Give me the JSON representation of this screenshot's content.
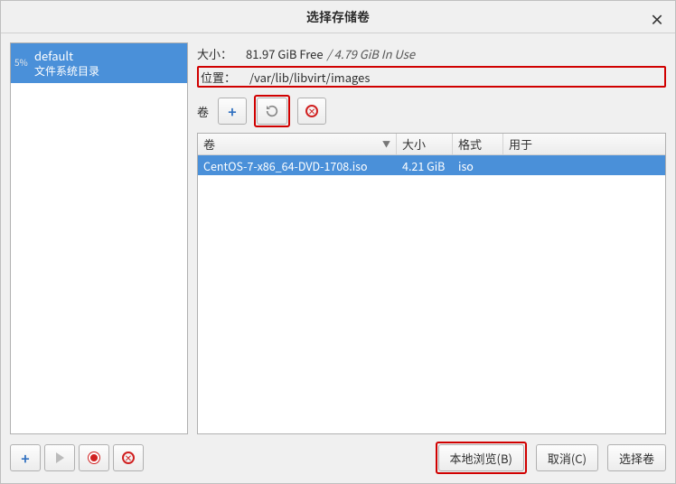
{
  "title": "选择存储卷",
  "sidebar": {
    "pools": [
      {
        "percent": "5%",
        "name": "default",
        "type": "文件系统目录"
      }
    ]
  },
  "info": {
    "size_label": "大小：",
    "size_free": "81.97 GiB Free",
    "size_sep": "/",
    "size_inuse": "4.79 GiB In Use",
    "loc_label": "位置：",
    "loc_value": "/var/lib/libvirt/images"
  },
  "vol_label": "卷",
  "columns": {
    "name": "卷",
    "size": "大小",
    "format": "格式",
    "used": "用于"
  },
  "rows": [
    {
      "name": "CentOS-7-x86_64-DVD-1708.iso",
      "size": "4.21 GiB",
      "format": "iso",
      "used": ""
    }
  ],
  "buttons": {
    "browse": "本地浏览(B)",
    "cancel": "取消(C)",
    "choose": "选择卷"
  }
}
